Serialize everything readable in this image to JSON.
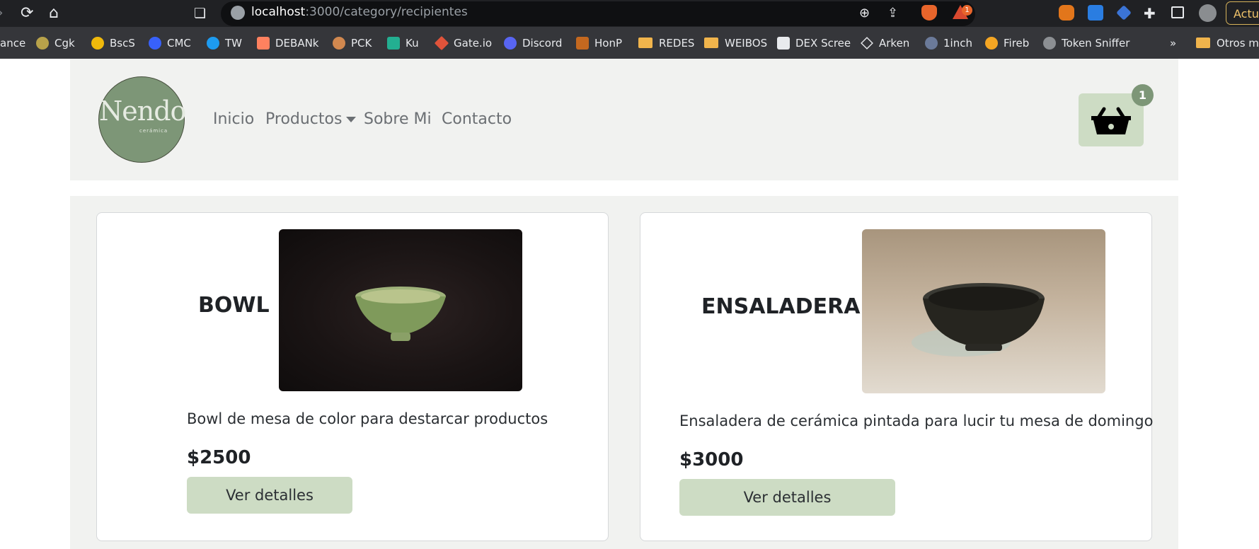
{
  "browser": {
    "url_host": "localhost",
    "url_path": ":3000/category/recipientes",
    "update_label": "Actual",
    "alert_badge": "1",
    "bookmarks": [
      {
        "label": "ance"
      },
      {
        "label": "Cgk"
      },
      {
        "label": "BscS"
      },
      {
        "label": "CMC"
      },
      {
        "label": "TW"
      },
      {
        "label": "DEBANk"
      },
      {
        "label": "PCK"
      },
      {
        "label": "Ku"
      },
      {
        "label": "Gate.io"
      },
      {
        "label": "Discord"
      },
      {
        "label": "HonP"
      },
      {
        "label": "REDES"
      },
      {
        "label": "WEIBOS"
      },
      {
        "label": "DEX Scree"
      },
      {
        "label": "Arken"
      },
      {
        "label": "1inch"
      },
      {
        "label": "Fireb"
      },
      {
        "label": "Token Sniffer"
      },
      {
        "label": "»"
      },
      {
        "label": "Otros ma"
      }
    ]
  },
  "header": {
    "logo_text": "Nendo",
    "logo_sub": "cerámica",
    "nav": [
      {
        "label": "Inicio"
      },
      {
        "label": "Productos"
      },
      {
        "label": "Sobre Mi"
      },
      {
        "label": "Contacto"
      }
    ],
    "cart_count": "1"
  },
  "products": [
    {
      "title": "BOWL",
      "description": "Bowl de mesa de color para destarcar productos",
      "price": "$2500",
      "button": "Ver detalles"
    },
    {
      "title": "ENSALADERA",
      "description": "Ensaladera de cerámica pintada para lucir tu mesa de domingo",
      "price": "$3000",
      "button": "Ver detalles"
    }
  ],
  "colors": {
    "accent_green": "#7d9677",
    "button_green": "#cddcc4",
    "section_bg": "#f1f2f0"
  }
}
